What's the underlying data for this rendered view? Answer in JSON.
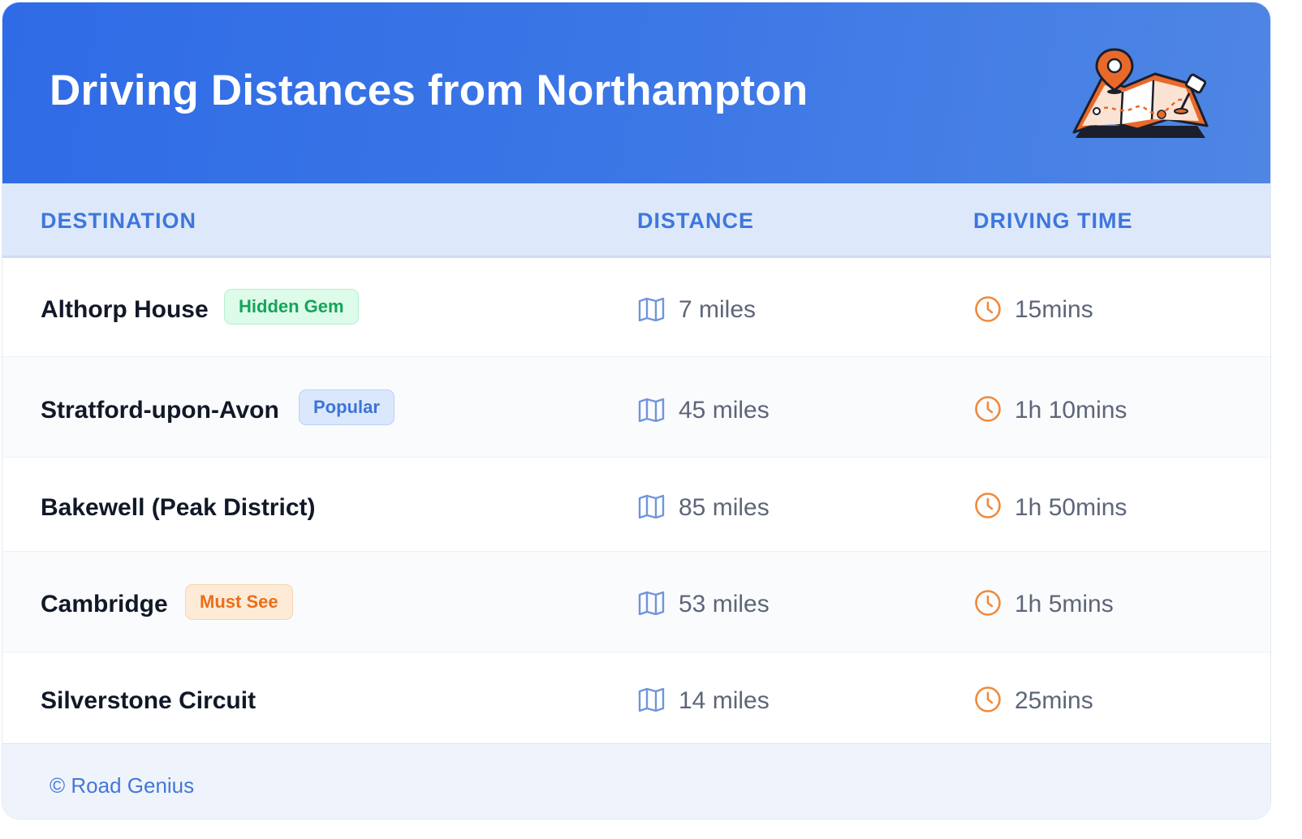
{
  "header": {
    "title": "Driving Distances from Northampton"
  },
  "table": {
    "columns": [
      "DESTINATION",
      "DISTANCE",
      "DRIVING TIME"
    ],
    "rows": [
      {
        "destination": "Althorp House",
        "badge": "Hidden Gem",
        "badge_color": "green",
        "distance": "7 miles",
        "time": "15mins"
      },
      {
        "destination": "Stratford-upon-Avon",
        "badge": "Popular",
        "badge_color": "blue",
        "distance": "45 miles",
        "time": "1h 10mins"
      },
      {
        "destination": "Bakewell (Peak District)",
        "badge": "",
        "badge_color": "",
        "distance": "85 miles",
        "time": "1h 50mins"
      },
      {
        "destination": "Cambridge",
        "badge": "Must See",
        "badge_color": "orange",
        "distance": "53 miles",
        "time": "1h 5mins"
      },
      {
        "destination": "Silverstone Circuit",
        "badge": "",
        "badge_color": "",
        "distance": "14 miles",
        "time": "25mins"
      }
    ]
  },
  "footer": {
    "credit": "© Road Genius"
  },
  "icons": {
    "distance": "map-icon",
    "time": "clock-icon",
    "header": "map-pin-illustration"
  },
  "colors": {
    "header_start": "#2f6be6",
    "header_end": "#4f86e4",
    "accent_blue": "#3f76dd",
    "clock_orange": "#f08a3c",
    "map_blue": "#6f95db"
  }
}
